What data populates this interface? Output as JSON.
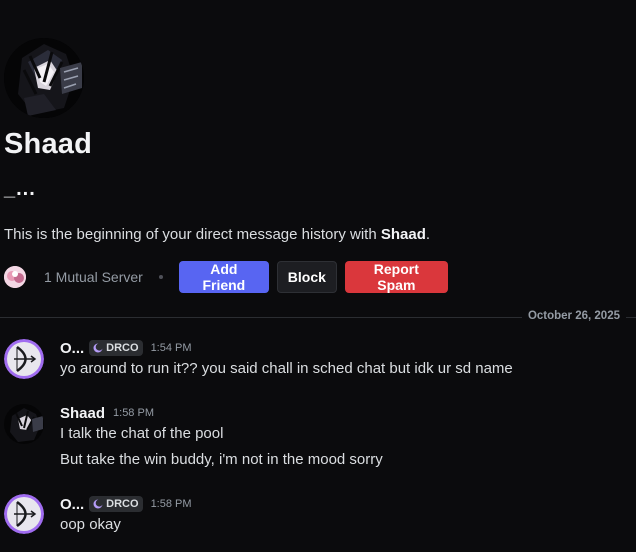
{
  "intro": {
    "name": "Shaad",
    "username": "_...",
    "beginning_text_prefix": "This is the beginning of your direct message history with ",
    "beginning_text_name": "Shaad",
    "beginning_text_suffix": ".",
    "mutual_servers": "1 Mutual Server"
  },
  "actions": {
    "add_friend": "Add Friend",
    "block": "Block",
    "report_spam": "Report Spam"
  },
  "divider": {
    "date": "October 26, 2025"
  },
  "messages": [
    {
      "author": "O...",
      "tag": "DRCO",
      "time": "1:54 PM",
      "lines": [
        "yo around to run it?? you said chall in sched chat but idk ur sd name"
      ]
    },
    {
      "author": "Shaad",
      "time": "1:58 PM",
      "lines": [
        "I talk the chat of the pool",
        "But take the win buddy, i'm not in the mood sorry"
      ]
    },
    {
      "author": "O...",
      "tag": "DRCO",
      "time": "1:58 PM",
      "lines": [
        "oop okay"
      ]
    }
  ],
  "colors": {
    "background": "#0b0b0d",
    "primary_button": "#5865f2",
    "danger_button": "#da373c",
    "avatar_ring": "#a06cf0"
  }
}
